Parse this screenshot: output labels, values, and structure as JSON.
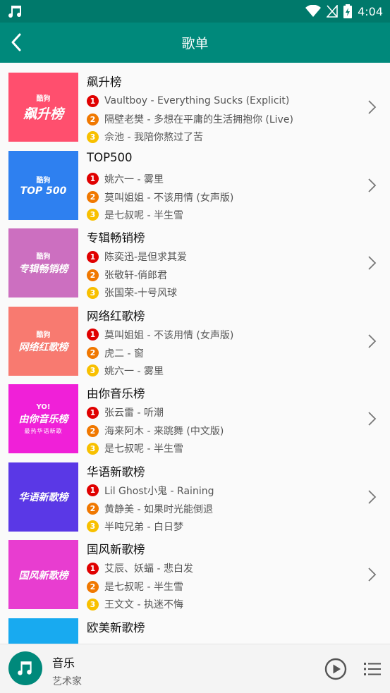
{
  "status": {
    "time": "4:04",
    "icons": [
      "music-note-icon",
      "wifi-icon",
      "signal-off-icon",
      "battery-charging-icon"
    ]
  },
  "appbar": {
    "title": "歌单",
    "back_icon": "back-arrow-icon"
  },
  "colors": {
    "statusbar": "#00796b",
    "appbar": "#00897b"
  },
  "playlists": [
    {
      "name": "飙升榜",
      "cover_brand": "酷狗",
      "cover_text": "飙升榜",
      "cover_color": "#ff4f6e",
      "tracks": [
        "Vaultboy - Everything Sucks (Explicit)",
        "隔壁老樊 - 多想在平庸的生活拥抱你 (Live)",
        "佘池 - 我陪你熬过了苦"
      ]
    },
    {
      "name": "TOP500",
      "cover_brand": "酷狗",
      "cover_text": "TOP 500",
      "cover_color": "#2e80f0",
      "tracks": [
        "姚六一 - 雾里",
        "莫叫姐姐 - 不该用情 (女声版)",
        "是七叔呢 - 半生雪"
      ]
    },
    {
      "name": "专辑畅销榜",
      "cover_brand": "酷狗",
      "cover_text": "专辑畅销榜",
      "cover_color": "#cc6fc0",
      "tracks": [
        "陈奕迅-是但求其爱",
        "张敬轩-俏郎君",
        "张国荣-十号风球"
      ]
    },
    {
      "name": "网络红歌榜",
      "cover_brand": "酷狗",
      "cover_text": "网络红歌榜",
      "cover_color": "#f87a70",
      "tracks": [
        "莫叫姐姐 - 不该用情 (女声版)",
        "虎二 - 窗",
        "姚六一 - 雾里"
      ]
    },
    {
      "name": "由你音乐榜",
      "cover_brand": "YO!",
      "cover_text": "由你音乐榜",
      "cover_sub": "最热华语新歌",
      "cover_color": "#f020d8",
      "tracks": [
        "张云雷 - 听潮",
        "海来阿木 - 来跳舞 (中文版)",
        "是七叔呢 - 半生雪"
      ]
    },
    {
      "name": "华语新歌榜",
      "cover_brand": "",
      "cover_text": "华语新歌榜",
      "cover_color": "#5a38e6",
      "tracks": [
        "Lil Ghost小鬼 - Raining",
        "黄静美 - 如果时光能倒退",
        "半吨兄弟 - 白日梦"
      ]
    },
    {
      "name": "国风新歌榜",
      "cover_brand": "",
      "cover_text": "国风新歌榜",
      "cover_color": "#e83dd0",
      "tracks": [
        "艾辰、妖蝠 - 悲白发",
        "是七叔呢 - 半生雪",
        "王文文 - 执迷不悔"
      ]
    },
    {
      "name": "欧美新歌榜",
      "cover_brand": "",
      "cover_text": "",
      "cover_color": "#18aaf0",
      "tracks": []
    }
  ],
  "player": {
    "title": "音乐",
    "artist": "艺术家",
    "play_icon": "play-circle-icon",
    "menu_icon": "playlist-menu-icon"
  }
}
